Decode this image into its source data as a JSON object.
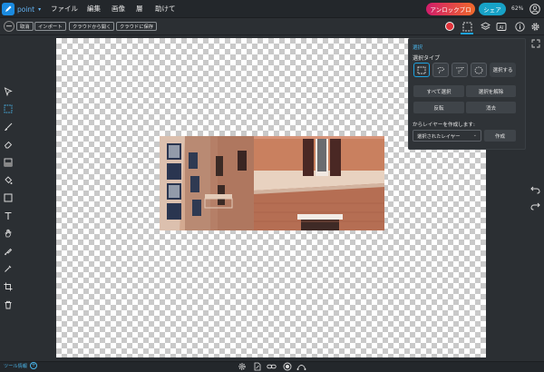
{
  "app": {
    "name": "point"
  },
  "menu": [
    "ファイル",
    "編集",
    "画像",
    "層",
    "助けて"
  ],
  "header": {
    "unlock_label": "アンロックプロ",
    "share_label": "シェア",
    "zoom": "62%"
  },
  "toolbar": {
    "back_label": "取消",
    "import_label": "インポート",
    "open_cloud_label": "クラウドから開く",
    "save_cloud_label": "クラウドに保存"
  },
  "panel": {
    "title": "選択",
    "selection_type_label": "選択タイプ",
    "select_label": "選択する",
    "select_all_label": "すべて選択",
    "deselect_label": "選択を解除",
    "invert_label": "反転",
    "erase_label": "消去",
    "create_layer_label": "からレイヤーを作成します:",
    "layer_option": "選択されたレイヤー",
    "create_label": "作成"
  },
  "footer": {
    "tool_info_label": "ツール情報"
  },
  "colors": {
    "accent": "#1ea2df",
    "color_swatch": "#e0323a",
    "unlock_gradient_start": "#d11c6a",
    "unlock_gradient_end": "#f06a2b",
    "share": "#17a2c7"
  }
}
